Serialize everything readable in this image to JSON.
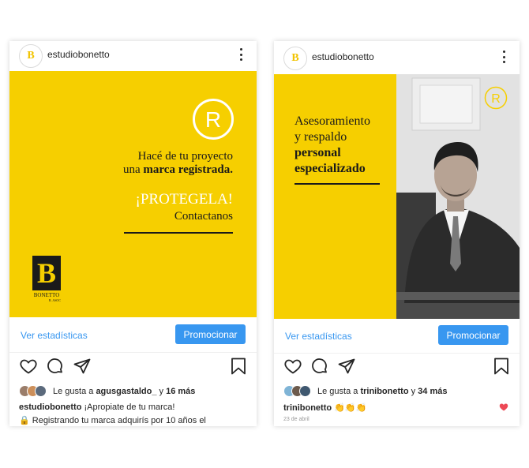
{
  "posts": [
    {
      "username": "estudiobonetto",
      "avatar_letter": "B",
      "headline_1": "Hacé de tu proyecto",
      "headline_2_prefix": "una ",
      "headline_2_bold": "marca registrada.",
      "cta": "¡PROTEGELA!",
      "cta_sub": "Contactanos",
      "logo_letter": "B",
      "logo_name": "BONETTO",
      "logo_tag": "B. ASOC",
      "registered_symbol": "R",
      "stats_link": "Ver estadísticas",
      "promote_label": "Promocionar",
      "likes_prefix": "Le gusta a ",
      "likes_user": "agusgastaldo_",
      "likes_mid": " y ",
      "likes_count": "16 más",
      "caption_user": "estudiobonetto",
      "caption_text": " ¡Apropiate de tu marca!",
      "caption_line2": "🔒 Registrando tu marca adquirís por 10 años el",
      "accent": "#f6cf00"
    },
    {
      "username": "estudiobonetto",
      "avatar_letter": "B",
      "headline_1": "Asesoramiento",
      "headline_2": "y respaldo",
      "headline_3": "personal",
      "headline_4": "especializado",
      "registered_symbol": "R",
      "stats_link": "Ver estadísticas",
      "promote_label": "Promocionar",
      "likes_prefix": "Le gusta a ",
      "likes_user": "trinibonetto",
      "likes_mid": " y ",
      "likes_count": "34 más",
      "caption_user": "trinibonetto",
      "caption_text": " 👏👏👏",
      "date": "23 de abril",
      "accent": "#f6cf00"
    }
  ],
  "icons": [
    "heart-icon",
    "comment-icon",
    "share-icon",
    "bookmark-icon",
    "more-icon",
    "registered-icon"
  ]
}
